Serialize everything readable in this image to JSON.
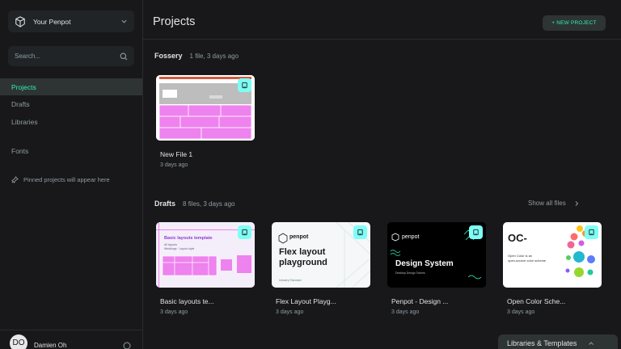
{
  "sidebar": {
    "team_name": "Your Penpot",
    "search_placeholder": "Search...",
    "nav": {
      "projects": "Projects",
      "drafts": "Drafts",
      "libraries": "Libraries",
      "fonts": "Fonts"
    },
    "pinned_note": "Pinned projects will appear here",
    "user": {
      "initials": "DO",
      "name": "Damien Oh"
    }
  },
  "header": {
    "title": "Projects",
    "new_project": "+ NEW PROJECT"
  },
  "fossery": {
    "name": "Fossery",
    "info": "1 file, 3 days ago",
    "files": [
      {
        "title": "New File 1",
        "date": "3 days ago"
      }
    ]
  },
  "drafts": {
    "name": "Drafts",
    "info": "8 files, 3 days ago",
    "show_all": "Show all files",
    "files": [
      {
        "title": "Basic layouts te...",
        "date": "3 days ago",
        "thumb_heading": "Basic layouts template",
        "thumb_line": "All layouts",
        "thumb_line2": "Weddings · Layout style"
      },
      {
        "title": "Flex Layout Playg...",
        "date": "3 days ago",
        "thumb_brand": "penpot",
        "thumb_heading_1": "Flex layout",
        "thumb_heading_2": "playground",
        "thumb_sub": "Industry Standard"
      },
      {
        "title": "Penpot - Design ...",
        "date": "3 days ago",
        "thumb_brand": "penpot",
        "thumb_heading": "Design System",
        "thumb_sub": "Desktop Design Tokens"
      },
      {
        "title": "Open Color Sche...",
        "date": "3 days ago",
        "thumb_heading": "OC-",
        "thumb_line": "Open Color is an",
        "thumb_line2": "open-source color scheme"
      }
    ]
  },
  "libraries_panel": "Libraries & Templates",
  "colors": {
    "accent": "#31efb8",
    "badge": "#7efff5",
    "pink": "#ee82ee",
    "bg": "#18181a"
  }
}
